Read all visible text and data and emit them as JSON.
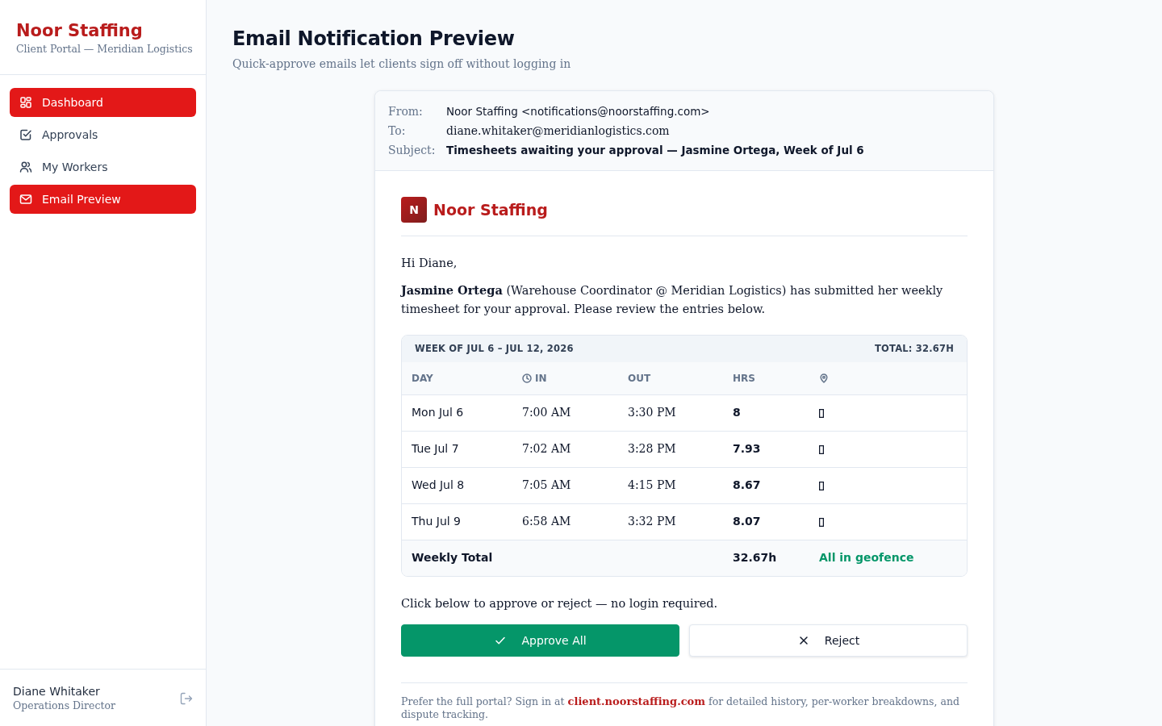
{
  "sidebar": {
    "brand": "Noor Staffing",
    "subtitle": "Client Portal — Meridian Logistics",
    "items": [
      {
        "label": "Dashboard",
        "selected": true
      },
      {
        "label": "Approvals",
        "selected": false
      },
      {
        "label": "My Workers",
        "selected": false
      },
      {
        "label": "Email Preview",
        "selected": true
      }
    ],
    "user": {
      "name": "Diane Whitaker",
      "role": "Operations Director"
    }
  },
  "page": {
    "title": "Email Notification Preview",
    "subtitle": "Quick-approve emails let clients sign off without logging in"
  },
  "email": {
    "headers": [
      {
        "label": "From:",
        "value": "Noor Staffing <notifications@noorstaffing.com>",
        "kind": "sender"
      },
      {
        "label": "To:",
        "value": "diane.whitaker@meridianlogistics.com",
        "kind": "recipient"
      },
      {
        "label": "Subject:",
        "value": "Timesheets awaiting your approval — Jasmine Ortega, Week of Jul 6",
        "kind": "subject"
      }
    ],
    "brand": {
      "initial": "N",
      "name": "Noor Staffing"
    },
    "greeting": "Hi Diane,",
    "intro": "**Jasmine Ortega** (Warehouse Coordinator @ Meridian Logistics) has submitted her weekly timesheet for your approval. Please review the entries below.",
    "timesheet": {
      "week": "WEEK OF JUL 6 – JUL 12, 2026",
      "total": "TOTAL: 32.67H",
      "columns": [
        "DAY",
        "IN",
        "OUT",
        "HRS"
      ],
      "rows": [
        {
          "day": "Mon Jul 6",
          "in": "7:00 AM",
          "out": "3:30 PM",
          "hrs": "8"
        },
        {
          "day": "Tue Jul 7",
          "in": "7:02 AM",
          "out": "3:28 PM",
          "hrs": "7.93"
        },
        {
          "day": "Wed Jul 8",
          "in": "7:05 AM",
          "out": "4:15 PM",
          "hrs": "8.67"
        },
        {
          "day": "Thu Jul 9",
          "in": "6:58 AM",
          "out": "3:32 PM",
          "hrs": "8.07"
        }
      ],
      "summary": {
        "label": "Weekly Total",
        "hours": "32.67h",
        "status": "All in geofence"
      }
    },
    "prompt": "Click below to approve or reject — no login required.",
    "buttons": [
      {
        "label": "Approve All",
        "kind": "approve"
      },
      {
        "label": "Reject",
        "kind": "reject"
      }
    ],
    "footer_note": {
      "before": "Prefer the full portal? Sign in at ",
      "link": "client.noorstaffing.com",
      "after": " for detailed history, per-worker breakdowns, and dispute tracking."
    }
  }
}
